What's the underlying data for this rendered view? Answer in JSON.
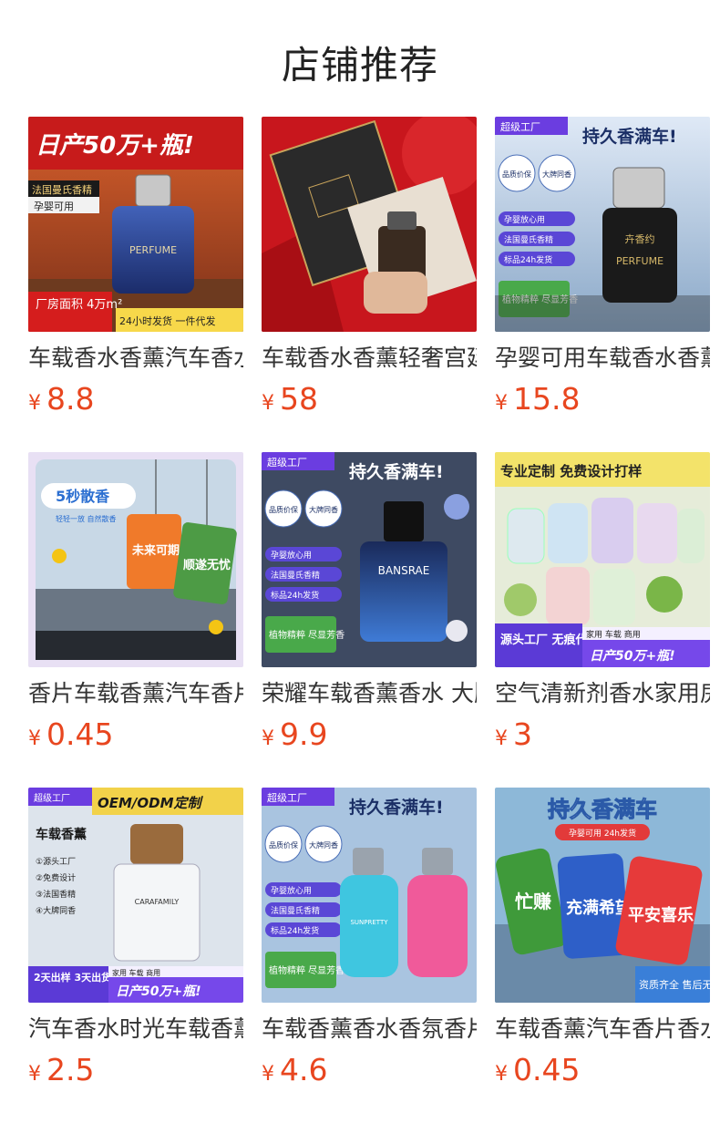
{
  "page": {
    "title": "店铺推荐"
  },
  "products": [
    {
      "name": "车载香水香薰汽车香水",
      "currency": "¥",
      "price": "8.8",
      "image": {
        "bg": "#c94a2a",
        "top_banner": "日产50万+瓶!",
        "tag1": "法国曼氏香精",
        "tag2": "孕婴可用",
        "bottle_label": "PERFUME",
        "bottom_left": "厂房面积 4万m²",
        "bottom_right": "24小时发货 一件代发"
      }
    },
    {
      "name": "车载香水香薰轻奢宫廷风",
      "currency": "¥",
      "price": "58",
      "image": {
        "bg": "#c8161d"
      }
    },
    {
      "name": "孕婴可用车载香水香薰",
      "currency": "¥",
      "price": "15.8",
      "image": {
        "bg": "#bcd3ea",
        "badge": "超级工厂",
        "headline": "持久香满车!",
        "seal1": "品质价保",
        "seal2": "大牌同香",
        "checks": [
          "孕婴放心用",
          "法国曼氏香精",
          "标品24h发货"
        ],
        "green_box": "植物精粹 尽显芳香",
        "bottle_label": "PERFUME",
        "bottle_brand": "卉香约"
      }
    },
    {
      "name": "香片车载香薰汽车香片",
      "currency": "¥",
      "price": "0.45",
      "image": {
        "bg": "#d9e6f2",
        "headline": "5秒散香",
        "sub": "轻轻一放 自然散香",
        "card1": "未来可期",
        "card2": "顺遂无忧"
      }
    },
    {
      "name": "荣耀车载香薰香水 大牌",
      "currency": "¥",
      "price": "9.9",
      "image": {
        "bg": "#3b4a6b",
        "badge": "超级工厂",
        "headline": "持久香满车!",
        "seal1": "品质价保",
        "seal2": "大牌同香",
        "checks": [
          "孕婴放心用",
          "法国曼氏香精",
          "标品24h发货"
        ],
        "green_box": "植物精粹 尽显芳香",
        "bottle_label": "BANSRAE"
      }
    },
    {
      "name": "空气清新剂香水家用房间",
      "currency": "¥",
      "price": "3",
      "image": {
        "bg": "#e8efe1",
        "top_banner": "专业定制 免费设计打样",
        "bottom_left": "源头工厂 无痕代发",
        "bottom_tag": "家用 车载 商用",
        "bottom_right": "日产50万+瓶!"
      }
    },
    {
      "name": "汽车香水时光车载香薰",
      "currency": "¥",
      "price": "2.5",
      "image": {
        "bg": "#dfe6ee",
        "badge": "超级工厂",
        "headline": "OEM/ODM定制",
        "title": "车载香薰",
        "list": [
          "①源头工厂",
          "②免费设计",
          "③法国香精",
          "④大牌同香"
        ],
        "bottle_label": "CARAFAMILY",
        "bottom_left": "2天出样 3天出货",
        "bottom_tag": "家用 车载 商用",
        "bottom_right": "日产50万+瓶!"
      }
    },
    {
      "name": "车载香薰香水香氛香片",
      "currency": "¥",
      "price": "4.6",
      "image": {
        "bg": "#a9c8e6",
        "badge": "超级工厂",
        "headline": "持久香满车!",
        "seal1": "品质价保",
        "seal2": "大牌同香",
        "checks": [
          "孕婴放心用",
          "法国曼氏香精",
          "标品24h发货"
        ],
        "green_box": "植物精粹 尽显芳香",
        "bottle_label": "SUNPRETTY"
      }
    },
    {
      "name": "车载香薰汽车香片香水",
      "currency": "¥",
      "price": "0.45",
      "image": {
        "bg": "#8db8d8",
        "headline": "持久香满车",
        "sub": "孕婴可用 24h发货",
        "card1": "忙赚",
        "card2": "充满希望",
        "card3": "平安喜乐",
        "bottom_right": "资质齐全 售后无忧"
      }
    }
  ]
}
